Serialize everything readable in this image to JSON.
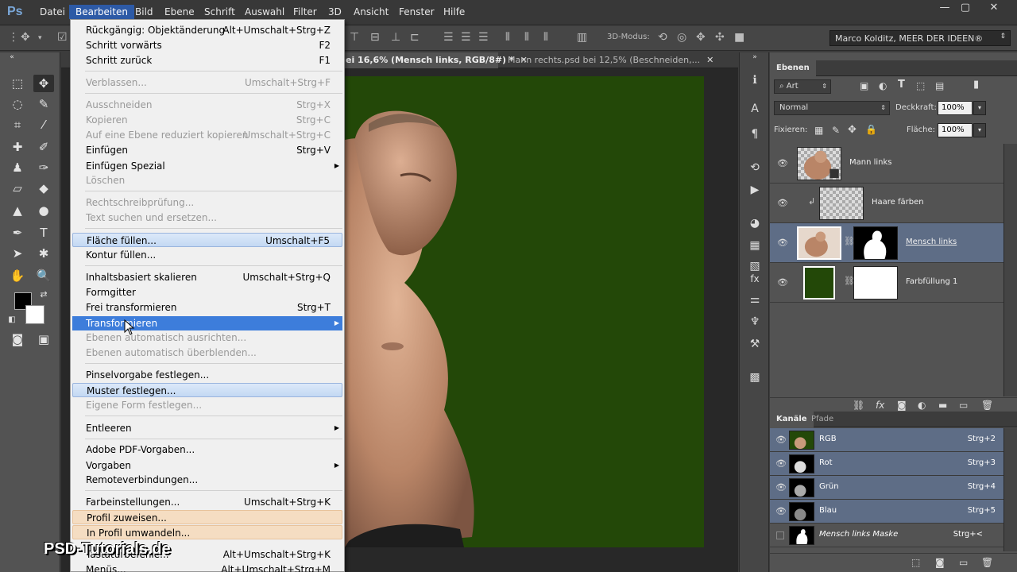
{
  "app": {
    "logo": "Ps"
  },
  "menubar": {
    "items": [
      "Datei",
      "Bearbeiten",
      "Bild",
      "Ebene",
      "Schrift",
      "Auswahl",
      "Filter",
      "3D",
      "Ansicht",
      "Fenster",
      "Hilfe"
    ]
  },
  "window_controls": {
    "minimize": "—",
    "restore": "▢",
    "close": "✕"
  },
  "options_bar": {
    "mode3d_label": "3D-Modus:",
    "workspace": "Marco Kolditz, MEER DER IDEEN®"
  },
  "doc_tabs": [
    {
      "label": "ei 16,6% (Mensch links, RGB/8#) *",
      "close": "✕"
    },
    {
      "label": "Mann rechts.psd bei 12,5% (Beschneiden,...",
      "close": "✕"
    }
  ],
  "edit_menu": {
    "items": [
      {
        "label": "Rückgängig: Objektänderung",
        "shortcut": "Alt+Umschalt+Strg+Z"
      },
      {
        "label": "Schritt vorwärts",
        "shortcut": "F2"
      },
      {
        "label": "Schritt zurück",
        "shortcut": "F1"
      },
      {
        "label": "Verblassen...",
        "shortcut": "Umschalt+Strg+F"
      },
      {
        "label": "Ausschneiden",
        "shortcut": "Strg+X"
      },
      {
        "label": "Kopieren",
        "shortcut": "Strg+C"
      },
      {
        "label": "Auf eine Ebene reduziert kopieren",
        "shortcut": "Umschalt+Strg+C"
      },
      {
        "label": "Einfügen",
        "shortcut": "Strg+V"
      },
      {
        "label": "Einfügen Spezial",
        "shortcut": ""
      },
      {
        "label": "Löschen",
        "shortcut": ""
      },
      {
        "label": "Rechtschreibprüfung...",
        "shortcut": ""
      },
      {
        "label": "Text suchen und ersetzen...",
        "shortcut": ""
      },
      {
        "label": "Fläche füllen...",
        "shortcut": "Umschalt+F5"
      },
      {
        "label": "Kontur füllen...",
        "shortcut": ""
      },
      {
        "label": "Inhaltsbasiert skalieren",
        "shortcut": "Umschalt+Strg+Q"
      },
      {
        "label": "Formgitter",
        "shortcut": ""
      },
      {
        "label": "Frei transformieren",
        "shortcut": "Strg+T"
      },
      {
        "label": "Transformieren",
        "shortcut": ""
      },
      {
        "label": "Ebenen automatisch ausrichten...",
        "shortcut": ""
      },
      {
        "label": "Ebenen automatisch überblenden...",
        "shortcut": ""
      },
      {
        "label": "Pinselvorgabe festlegen...",
        "shortcut": ""
      },
      {
        "label": "Muster festlegen...",
        "shortcut": ""
      },
      {
        "label": "Eigene Form festlegen...",
        "shortcut": ""
      },
      {
        "label": "Entleeren",
        "shortcut": ""
      },
      {
        "label": "Adobe PDF-Vorgaben...",
        "shortcut": ""
      },
      {
        "label": "Vorgaben",
        "shortcut": ""
      },
      {
        "label": "Remoteverbindungen...",
        "shortcut": ""
      },
      {
        "label": "Farbeinstellungen...",
        "shortcut": "Umschalt+Strg+K"
      },
      {
        "label": "Profil zuweisen...",
        "shortcut": ""
      },
      {
        "label": "In Profil umwandeln...",
        "shortcut": ""
      },
      {
        "label": "Tastaturbefehle...",
        "shortcut": "Alt+Umschalt+Strg+K"
      },
      {
        "label": "Menüs...",
        "shortcut": "Alt+Umschalt+Strg+M"
      }
    ]
  },
  "watermark": "PSD-Tutorials.de",
  "layers_panel": {
    "tab": "Ebenen",
    "filter_kind": "Art",
    "blend_mode": "Normal",
    "opacity_label": "Deckkraft:",
    "opacity": "100%",
    "lock_label": "Fixieren:",
    "fill_label": "Fläche:",
    "fill": "100%",
    "layers": [
      {
        "name": "Mann links"
      },
      {
        "name": "Haare färben"
      },
      {
        "name": "Mensch links"
      },
      {
        "name": "Farbfüllung 1"
      }
    ]
  },
  "channels_panel": {
    "tabs": [
      "Kanäle",
      "Pfade"
    ],
    "channels": [
      {
        "name": "RGB",
        "shortcut": "Strg+2"
      },
      {
        "name": "Rot",
        "shortcut": "Strg+3"
      },
      {
        "name": "Grün",
        "shortcut": "Strg+4"
      },
      {
        "name": "Blau",
        "shortcut": "Strg+5"
      },
      {
        "name": "Mensch links Maske",
        "shortcut": "Strg+<"
      }
    ]
  },
  "colors": {
    "canvas_bg": "#234808",
    "menu_highlight": "#3d7ddb",
    "selected_row": "#5e6d86"
  }
}
